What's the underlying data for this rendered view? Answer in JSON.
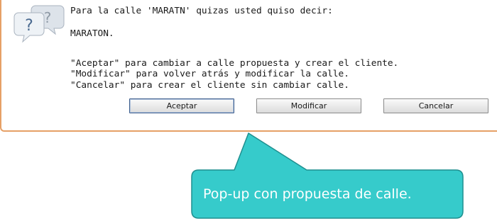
{
  "dialog": {
    "message_line1": "Para la calle 'MARATN' quizas usted quiso decir:",
    "suggestion": "MARATON.",
    "help_accept": "\"Aceptar\" para cambiar a calle propuesta y crear el cliente.",
    "help_modify": "\"Modificar\" para volver atrás y modificar la calle.",
    "help_cancel": "\"Cancelar\" para crear el cliente sin cambiar calle.",
    "icon": "question-bubbles-icon",
    "buttons": {
      "accept": "Aceptar",
      "modify": "Modificar",
      "cancel": "Cancelar"
    }
  },
  "callout": {
    "text": "Pop-up con propuesta de calle.",
    "color": "#36cbcb"
  },
  "colors": {
    "dialog_border": "#e6a066",
    "accept_border": "#3c5d8c"
  }
}
